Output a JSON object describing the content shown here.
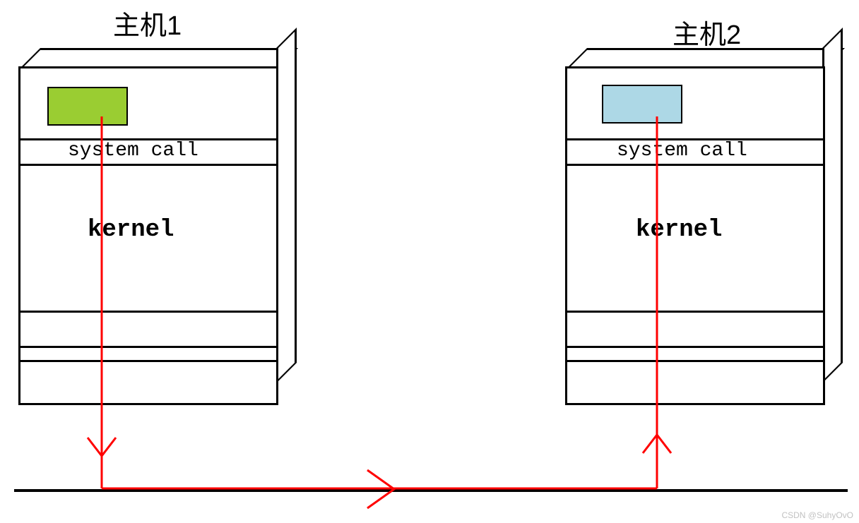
{
  "host1": {
    "title": "主机1",
    "syscall": "system call",
    "kernel": "kernel"
  },
  "host2": {
    "title": "主机2",
    "syscall": "system call",
    "kernel": "kernel"
  },
  "colors": {
    "app1": "#9acd32",
    "app2": "#add8e6",
    "arrow": "#ff0000"
  },
  "watermark": "CSDN @SuhyOvO"
}
